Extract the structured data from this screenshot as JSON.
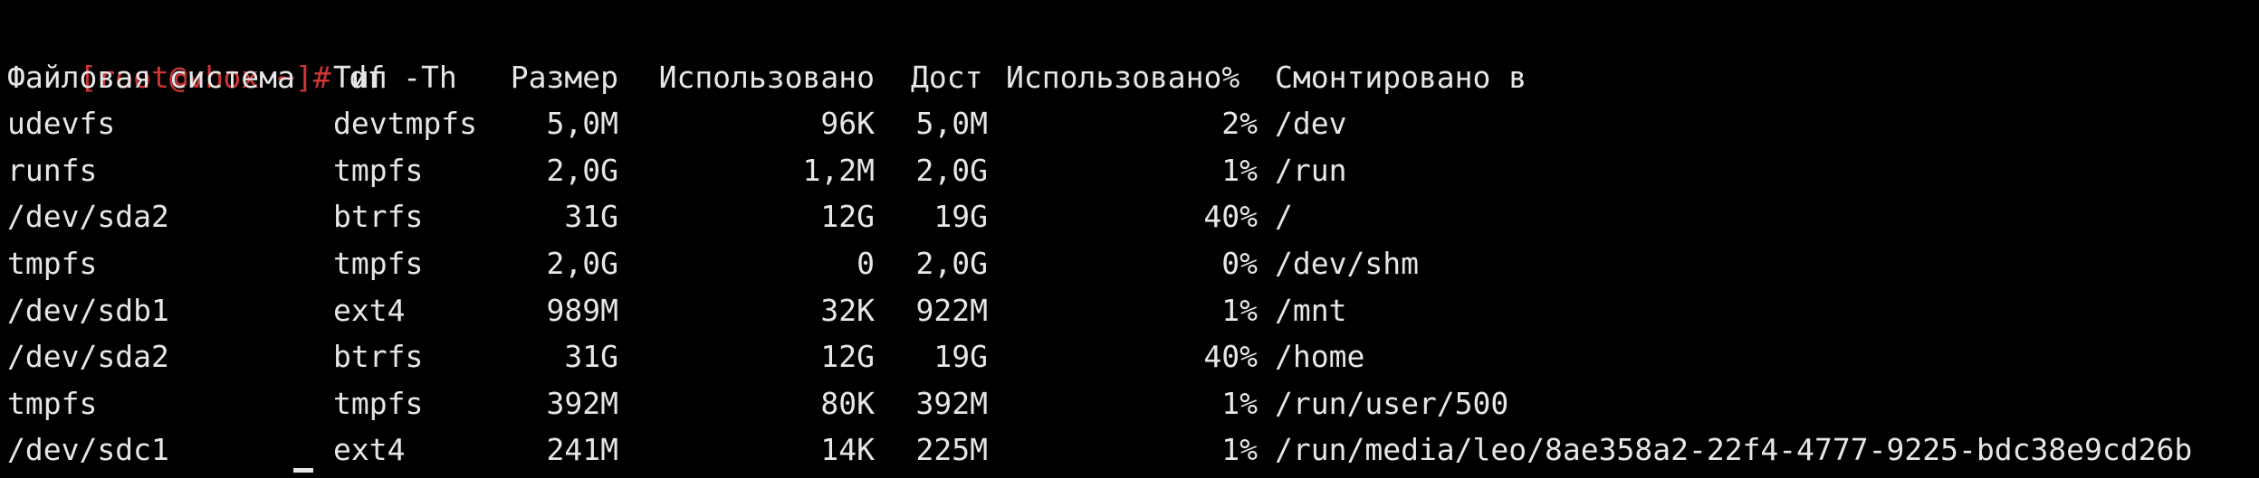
{
  "terminal": {
    "prompt": "[root@vbox ~]#",
    "command": " df -Th"
  },
  "headers": {
    "filesystem": "Файловая система",
    "type": "Тип",
    "size": "Размер",
    "used": "Использовано",
    "avail": "Дост",
    "use_percent": "Использовано%",
    "mounted_on": "Смонтировано в"
  },
  "rows": [
    {
      "fs": "udevfs",
      "type": "devtmpfs",
      "size": "5,0M",
      "used": "96K",
      "avail": "5,0M",
      "pct": "2%",
      "mount": "/dev"
    },
    {
      "fs": "runfs",
      "type": "tmpfs",
      "size": "2,0G",
      "used": "1,2M",
      "avail": "2,0G",
      "pct": "1%",
      "mount": "/run"
    },
    {
      "fs": "/dev/sda2",
      "type": "btrfs",
      "size": "31G",
      "used": "12G",
      "avail": "19G",
      "pct": "40%",
      "mount": "/"
    },
    {
      "fs": "tmpfs",
      "type": "tmpfs",
      "size": "2,0G",
      "used": "0",
      "avail": "2,0G",
      "pct": "0%",
      "mount": "/dev/shm"
    },
    {
      "fs": "/dev/sdb1",
      "type": "ext4",
      "size": "989M",
      "used": "32K",
      "avail": "922M",
      "pct": "1%",
      "mount": "/mnt"
    },
    {
      "fs": "/dev/sda2",
      "type": "btrfs",
      "size": "31G",
      "used": "12G",
      "avail": "19G",
      "pct": "40%",
      "mount": "/home"
    },
    {
      "fs": "tmpfs",
      "type": "tmpfs",
      "size": "392M",
      "used": "80K",
      "avail": "392M",
      "pct": "1%",
      "mount": "/run/user/500"
    },
    {
      "fs": "/dev/sdc1",
      "type": "ext4",
      "size": "241M",
      "used": "14K",
      "avail": "225M",
      "pct": "1%",
      "mount": "/run/media/leo/8ae358a2-22f4-4777-9225-bdc38e9cd26b"
    }
  ],
  "colors": {
    "background": "#000000",
    "foreground": "#e6e6e6",
    "prompt": "#d03434"
  }
}
